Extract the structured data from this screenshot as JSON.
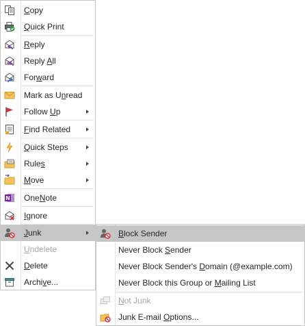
{
  "main_menu": {
    "items": [
      {
        "pre": "",
        "ul": "C",
        "post": "opy",
        "icon": "copy-icon"
      },
      {
        "pre": "",
        "ul": "Q",
        "post": "uick Print",
        "icon": "printer-icon"
      },
      {
        "pre": "",
        "ul": "R",
        "post": "eply",
        "icon": "reply-icon"
      },
      {
        "pre": "Reply ",
        "ul": "A",
        "post": "ll",
        "icon": "reply-all-icon"
      },
      {
        "pre": "For",
        "ul": "w",
        "post": "ard",
        "icon": "forward-icon"
      },
      {
        "pre": "Mark as U",
        "ul": "n",
        "post": "read",
        "icon": "envelope-icon"
      },
      {
        "pre": "Follow ",
        "ul": "U",
        "post": "p",
        "icon": "flag-icon"
      },
      {
        "pre": "",
        "ul": "F",
        "post": "ind Related",
        "icon": "find-related-icon"
      },
      {
        "pre": "",
        "ul": "Q",
        "post": "uick Steps",
        "icon": "lightning-icon"
      },
      {
        "pre": "Rule",
        "ul": "s",
        "post": "",
        "icon": "rules-icon"
      },
      {
        "pre": "",
        "ul": "M",
        "post": "ove",
        "icon": "move-folder-icon"
      },
      {
        "pre": "One",
        "ul": "N",
        "post": "ote",
        "icon": "onenote-icon"
      },
      {
        "pre": "",
        "ul": "I",
        "post": "gnore",
        "icon": "ignore-icon"
      },
      {
        "pre": "",
        "ul": "J",
        "post": "unk",
        "icon": "junk-icon"
      },
      {
        "pre": "",
        "ul": "U",
        "post": "ndelete",
        "icon": "undelete-icon"
      },
      {
        "pre": "",
        "ul": "D",
        "post": "elete",
        "icon": "delete-icon"
      },
      {
        "pre": "Archi",
        "ul": "v",
        "post": "e...",
        "icon": "archive-icon"
      }
    ]
  },
  "junk_submenu": {
    "items": [
      {
        "pre": "",
        "ul": "B",
        "post": "lock Sender",
        "icon": "block-sender-icon"
      },
      {
        "pre": "Never Block ",
        "ul": "S",
        "post": "ender",
        "icon": ""
      },
      {
        "pre": "Never Block Sender's ",
        "ul": "D",
        "post": "omain (@example.com)",
        "icon": ""
      },
      {
        "pre": "Never Block this Group or ",
        "ul": "M",
        "post": "ailing List",
        "icon": ""
      },
      {
        "pre": "",
        "ul": "N",
        "post": "ot Junk",
        "icon": "not-junk-icon"
      },
      {
        "pre": "Junk E-mail ",
        "ul": "O",
        "post": "ptions...",
        "icon": "junk-options-icon"
      }
    ]
  },
  "colors": {
    "highlight": "#c6c6c6",
    "border": "#c6c6c6",
    "text": "#262626",
    "disabled_text": "#a6a6a6"
  }
}
